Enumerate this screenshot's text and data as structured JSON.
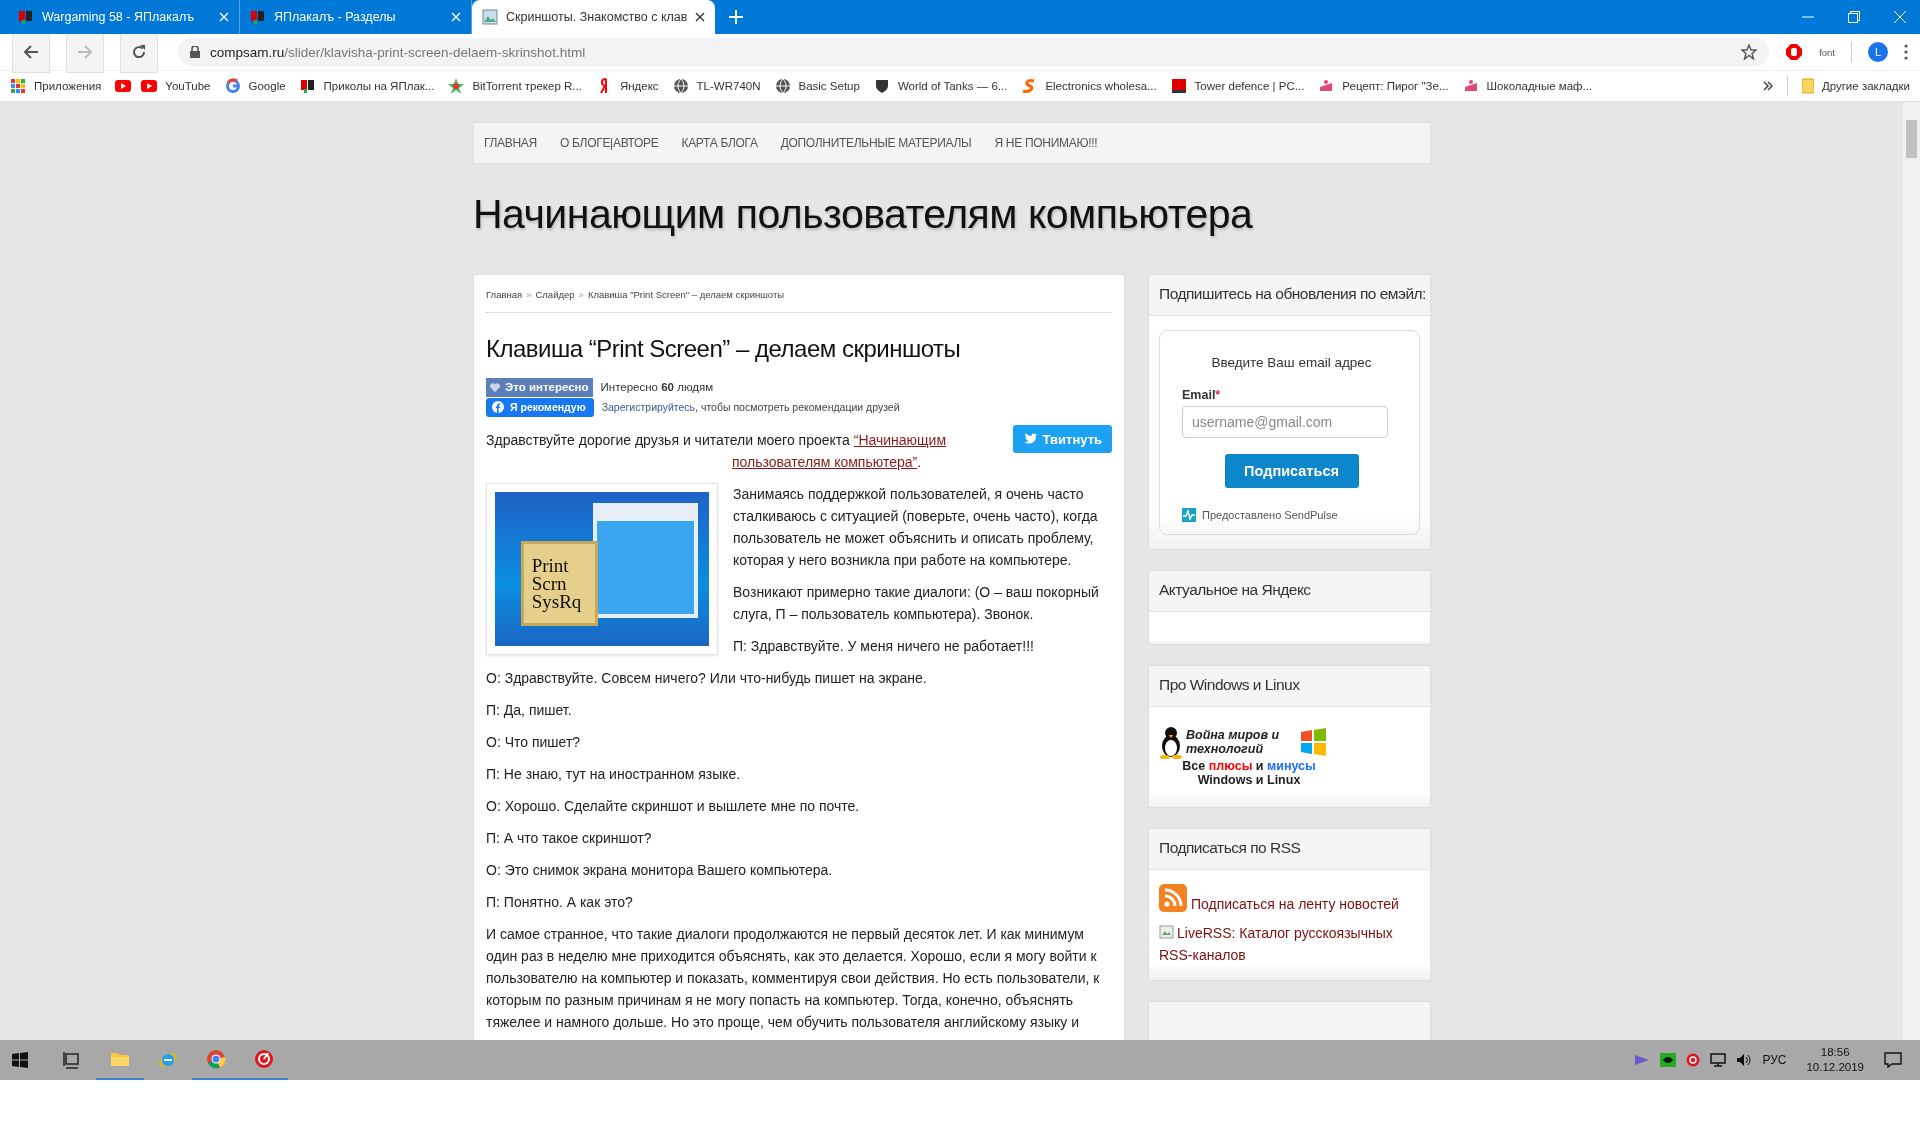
{
  "browser": {
    "tabs": [
      {
        "title": "Wargaming 58 - ЯПлакалъ",
        "selected": false
      },
      {
        "title": "ЯПлакалъ - Разделы",
        "selected": false
      },
      {
        "title": "Скриншоты. Знакомство с клав",
        "selected": true
      }
    ],
    "address": {
      "domain": "compsam.ru",
      "path": "/slider/klavisha-print-screen-delaem-skrinshot.html"
    },
    "extension_label": "font",
    "profile_initial": "L",
    "bookmarks": [
      {
        "kind": "link",
        "label": "Приложения"
      },
      {
        "kind": "icon"
      },
      {
        "kind": "link",
        "label": "YouTube"
      },
      {
        "kind": "link",
        "label": "Google"
      },
      {
        "kind": "link",
        "label": "Приколы на ЯПлак..."
      },
      {
        "kind": "link",
        "label": "BitTorrent трекер R..."
      },
      {
        "kind": "link",
        "label": "Яндекс"
      },
      {
        "kind": "link",
        "label": "TL-WR740N"
      },
      {
        "kind": "link",
        "label": "Basic Setup"
      },
      {
        "kind": "link",
        "label": "World of Tanks — 6..."
      },
      {
        "kind": "link",
        "label": "Electronics wholesa..."
      },
      {
        "kind": "link",
        "label": "Tower defence | PC..."
      },
      {
        "kind": "link",
        "label": "Рецепт: Пирог \"Зе..."
      },
      {
        "kind": "link",
        "label": "Шоколадные маф..."
      }
    ],
    "other_bookmarks": "Другие закладки"
  },
  "page": {
    "nav": [
      "ГЛАВНАЯ",
      "О БЛОГЕ|АВТОРЕ",
      "КАРТА БЛОГА",
      "ДОПОЛНИТЕЛЬНЫЕ МАТЕРИАЛЫ",
      "Я НЕ ПОНИМАЮ!!!"
    ],
    "site_title": "Начинающим пользователям компьютера",
    "breadcrumb": [
      "Главная",
      "Слайдер",
      "Клавиша \"Print Screen\" – делаем скриншоты"
    ],
    "breadcrumb_separator": "»",
    "article_title": "Клавиша “Print Screen” – делаем скриншоты",
    "like_button": "Это интересно",
    "like_count": "Интересно **60** людям",
    "recommend_button": "Я рекомендую",
    "register_link": "Зарегистрируйтесь",
    "register_text": ", чтобы посмотреть рекомендации друзей",
    "tweet_button": "Твитнуть",
    "intro": {
      "text": "Здравствуйте дорогие друзья и читатели моего проекта ",
      "link_parts": [
        "“Начинающим",
        "пользователям компьютера”"
      ],
      "after": "."
    },
    "image_key_label": [
      "Print",
      "Scrn",
      "SysRq"
    ],
    "beside_image": [
      "Занимаясь поддержкой пользователей, я очень часто сталкиваюсь с ситуацией (поверьте, очень часто), когда пользователь не может объяснить и описать проблему, которая у него возникла при работе на компьютере.",
      "Возникают примерно такие диалоги: (О – ваш покорный слуга, П – пользователь компьютера). Звонок.",
      "П:  Здравствуйте. У меня ничего не работает!!!"
    ],
    "paragraphs": [
      "О: Здравствуйте. Совсем ничего? Или что-нибудь пишет на экране.",
      "П: Да, пишет.",
      "О: Что пишет?",
      "П: Не знаю, тут на иностранном языке.",
      "О: Хорошо. Сделайте скриншот и вышлете мне по почте.",
      "П: А что такое скриншот?",
      "О: Это снимок экрана монитора Вашего компьютера.",
      "П: Понятно. А как это?",
      "И самое странное, что такие диалоги продолжаются не первый десяток лет. И как минимум один раз в неделю мне приходится объяснять, как это делается. Хорошо, если я могу войти к пользователю на компьютер и показать, комментируя свои действия. Но есть пользователи, к которым по разным причинам я не могу попасть на компьютер. Тогда, конечно, объяснять тяжелее и намного дольше. Но это проще, чем обучить пользователя английскому языку и"
    ],
    "widgets": [
      {
        "kind": "subscribe",
        "title": "Подпишитесь на обновления по емэйл:",
        "prompt": "Введите Ваш email адрес",
        "field_label": "Email",
        "required_mark": "*",
        "placeholder": "username@gmail.com",
        "button": "Подписаться",
        "credit": "Предоставлено SendPulse"
      },
      {
        "kind": "empty",
        "title": "Актуальное на Яндекс"
      },
      {
        "kind": "banner",
        "title": "Про Windows и Linux",
        "line1": "Война миров и технологий",
        "words": [
          {
            "text": "Все"
          },
          {
            "text": "плюсы",
            "color": "#ff0000"
          },
          {
            "text": "и"
          },
          {
            "text": "минусы",
            "color": "#1f6bff"
          }
        ],
        "line3": "Windows и Linux"
      },
      {
        "kind": "rss",
        "title": "Подписаться по RSS",
        "link": "Подписаться на ленту новостей",
        "broken_image_alt": "LiveRSS: Каталог русскоязычных RSS-каналов"
      },
      {
        "kind": "empty"
      }
    ]
  },
  "taskbar": {
    "apps": [
      {
        "open": false
      },
      {
        "open": true
      },
      {
        "open": false
      },
      {
        "open": true
      },
      {
        "open": true
      }
    ],
    "language": "РУС",
    "time": "18:56",
    "date": "10.12.2019"
  }
}
